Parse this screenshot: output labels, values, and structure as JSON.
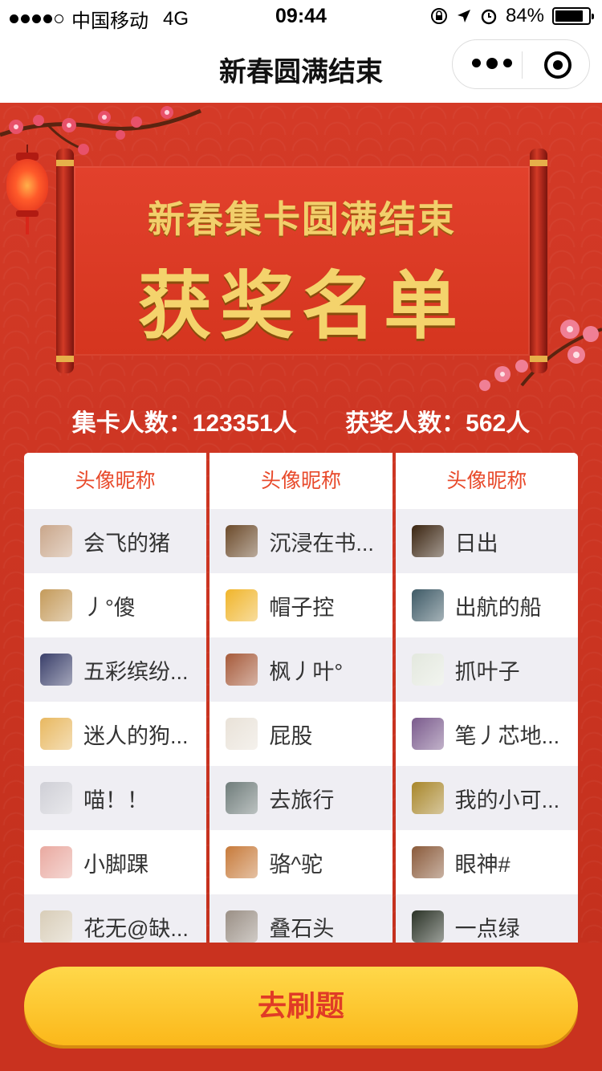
{
  "status_bar": {
    "carrier": "中国移动",
    "network": "4G",
    "time": "09:44",
    "battery": "84%",
    "battery_level": 0.84
  },
  "nav": {
    "title": "新春圆满结束"
  },
  "banner": {
    "line1": "新春集卡圆满结束",
    "line2": "获奖名单"
  },
  "stats": {
    "collectors": "集卡人数：123351人",
    "winners": "获奖人数：562人"
  },
  "table": {
    "header": "头像昵称",
    "columns": [
      [
        {
          "nick": "会飞的猪",
          "color": "#c9a68a"
        },
        {
          "nick": "丿°傻",
          "color": "#c49a5a"
        },
        {
          "nick": "五彩缤纷...",
          "color": "#3a3f6a"
        },
        {
          "nick": "迷人的狗...",
          "color": "#e8b860"
        },
        {
          "nick": "喵！！",
          "color": "#cfcfd6"
        },
        {
          "nick": "小脚踝",
          "color": "#e9a9a0"
        },
        {
          "nick": "花无@缺...",
          "color": "#d8cdb8"
        }
      ],
      [
        {
          "nick": "沉浸在书...",
          "color": "#6b4a2a"
        },
        {
          "nick": "帽子控",
          "color": "#f0b52b"
        },
        {
          "nick": "枫丿叶°",
          "color": "#a65a3a"
        },
        {
          "nick": "屁股",
          "color": "#e9e2d8"
        },
        {
          "nick": "去旅行",
          "color": "#6f7c7a"
        },
        {
          "nick": "骆^驼",
          "color": "#c77a3a"
        },
        {
          "nick": "叠石头",
          "color": "#9a8f85"
        }
      ],
      [
        {
          "nick": "日出",
          "color": "#3a2410"
        },
        {
          "nick": "出航的船",
          "color": "#3e5a66"
        },
        {
          "nick": "抓叶子",
          "color": "#e3e8de"
        },
        {
          "nick": "笔丿芯地...",
          "color": "#7a5a8c"
        },
        {
          "nick": "我的小可...",
          "color": "#a8862a"
        },
        {
          "nick": "眼神#",
          "color": "#8a5a3a"
        },
        {
          "nick": "一点绿",
          "color": "#2a3226"
        }
      ]
    ]
  },
  "footer": {
    "button_label": "去刷题"
  },
  "colors": {
    "accent": "#e84a2b",
    "background": "#c9321f",
    "button": "#fbb81a",
    "gold": "#f2cf6b"
  }
}
